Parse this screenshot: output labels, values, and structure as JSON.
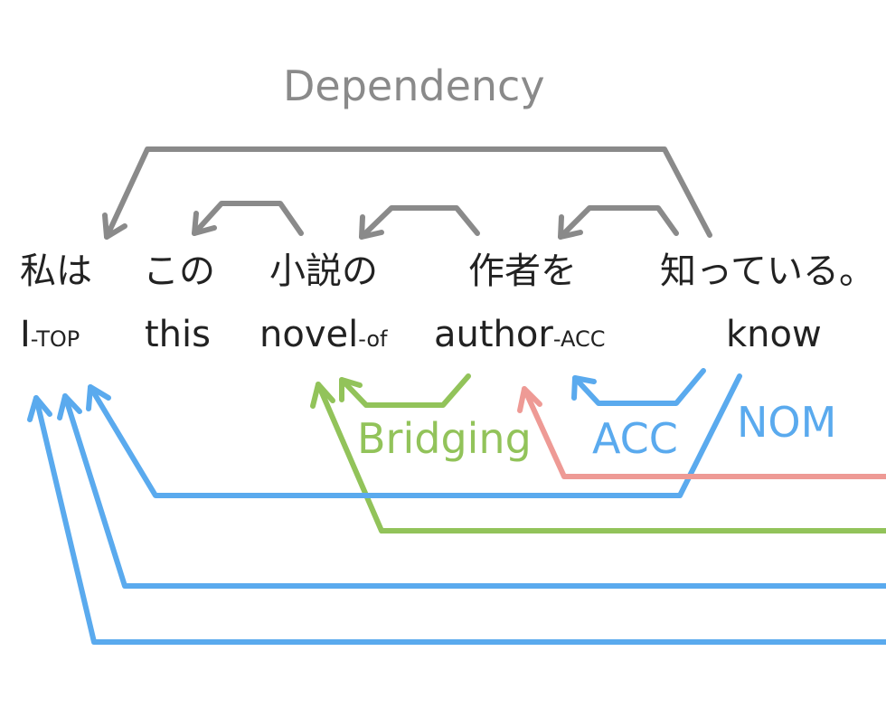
{
  "title": "Dependency",
  "tokens": [
    {
      "jp": "私は",
      "en": "I",
      "en_suffix": "-TOP"
    },
    {
      "jp": "この",
      "en": "this",
      "en_suffix": ""
    },
    {
      "jp": "小説の",
      "en": "novel",
      "en_suffix": "-of"
    },
    {
      "jp": "作者を",
      "en": "author",
      "en_suffix": "-ACC"
    },
    {
      "jp": "知っている。",
      "en": "know",
      "en_suffix": ""
    }
  ],
  "relations": {
    "bridging": "Bridging",
    "acc": "ACC",
    "nom": "NOM"
  },
  "colors": {
    "dependency": "#8a8a8a",
    "bridging": "#92c35a",
    "acc": "#5aaaee",
    "nom": "#5aaaee",
    "red": "#ee9a95"
  }
}
